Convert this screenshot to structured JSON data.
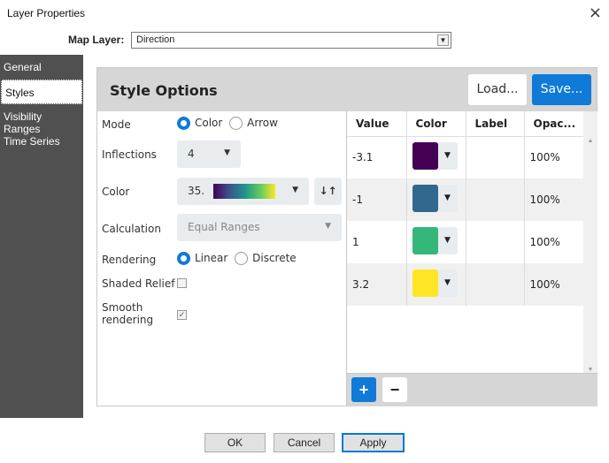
{
  "window": {
    "title": "Layer Properties",
    "close_icon": "×"
  },
  "map_layer": {
    "label": "Map Layer:",
    "value": "Direction"
  },
  "sidebar": {
    "items": [
      {
        "label": "General",
        "active": false
      },
      {
        "label": "Styles",
        "active": true
      },
      {
        "label": "Visibility Ranges",
        "active": false
      },
      {
        "label": "Time Series",
        "active": false
      }
    ]
  },
  "panel": {
    "title": "Style Options",
    "load_label": "Load...",
    "save_label": "Save...",
    "mode": {
      "label": "Mode",
      "options": [
        "Color",
        "Arrow"
      ],
      "selected": "Color"
    },
    "inflections": {
      "label": "Inflections",
      "value": "4"
    },
    "color": {
      "label": "Color",
      "value": "35.",
      "reverse_icon": "↓↑"
    },
    "calculation": {
      "label": "Calculation",
      "value": "Equal Ranges"
    },
    "rendering": {
      "label": "Rendering",
      "options": [
        "Linear",
        "Discrete"
      ],
      "selected": "Linear"
    },
    "shaded_relief": {
      "label": "Shaded Relief",
      "checked": false
    },
    "smooth_rendering": {
      "label_1": "Smooth",
      "label_2": "rendering",
      "checked": true
    },
    "table": {
      "headers": [
        "Value",
        "Color",
        "Label",
        "Opac..."
      ],
      "rows": [
        {
          "value": "-3.1",
          "color": "#440154",
          "label": "",
          "opacity": "100%"
        },
        {
          "value": "-1",
          "color": "#31688e",
          "label": "",
          "opacity": "100%"
        },
        {
          "value": "1",
          "color": "#35b779",
          "label": "",
          "opacity": "100%"
        },
        {
          "value": "3.2",
          "color": "#fde725",
          "label": "",
          "opacity": "100%"
        }
      ]
    },
    "add_label": "+",
    "remove_label": "−"
  },
  "buttons": {
    "ok": "OK",
    "cancel": "Cancel",
    "apply": "Apply"
  }
}
